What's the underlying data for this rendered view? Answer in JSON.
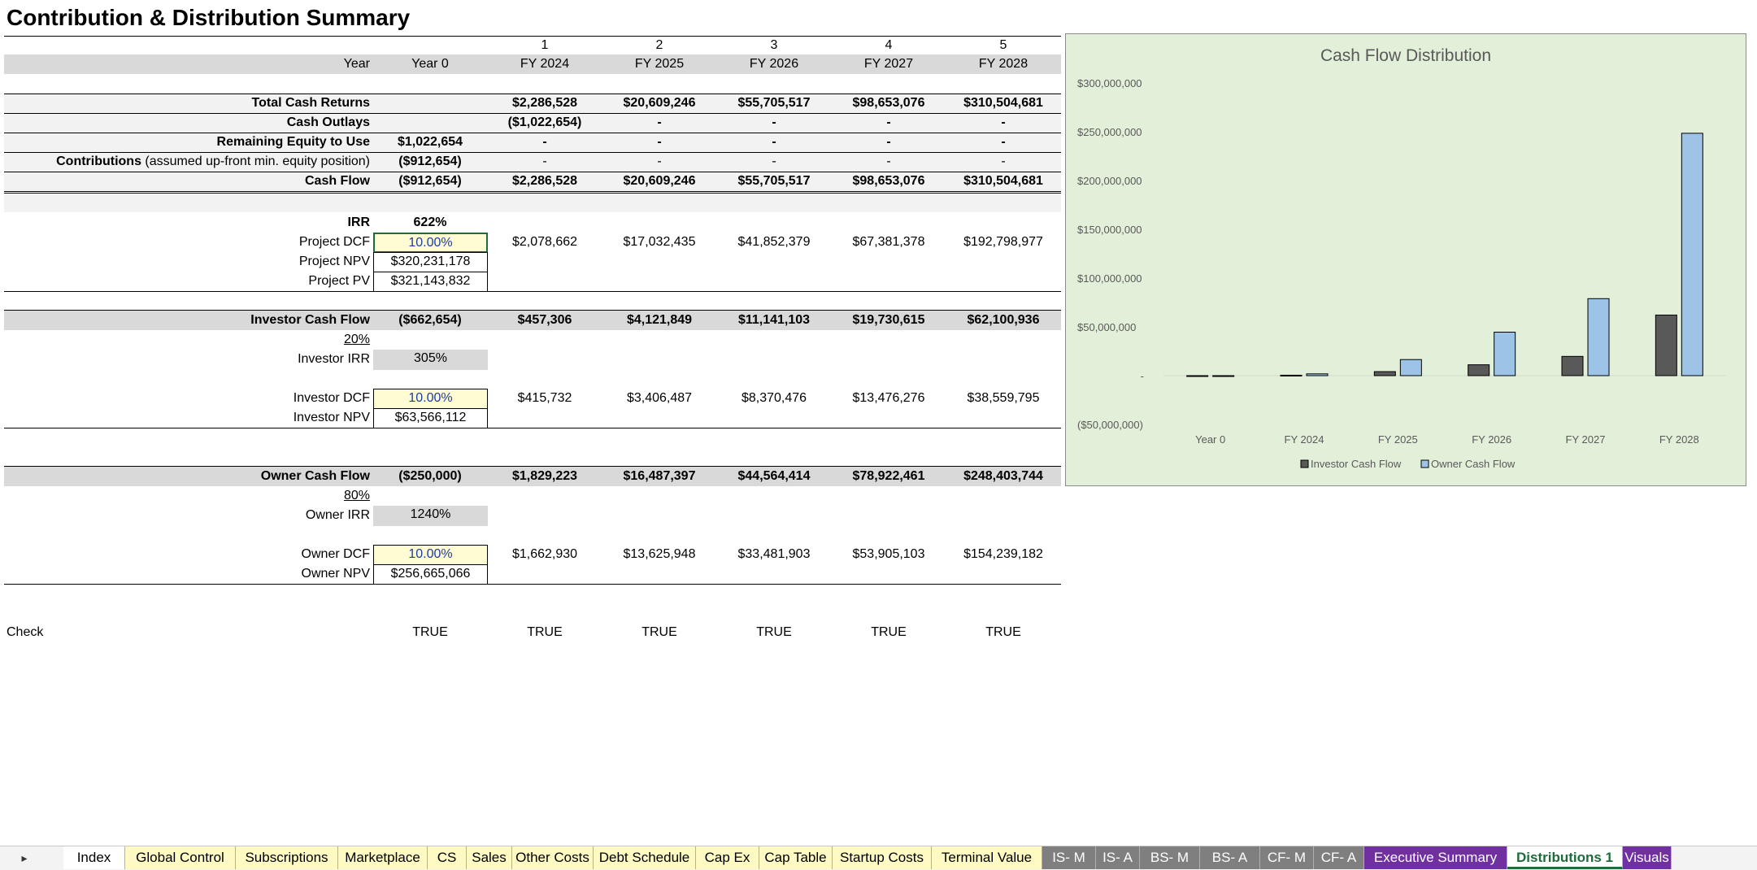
{
  "sheet": {
    "title": "Contribution & Distribution Summary",
    "period_numbers": [
      "1",
      "2",
      "3",
      "4",
      "5"
    ],
    "header": {
      "label": "Year",
      "cols": [
        "Year 0",
        "FY 2024",
        "FY 2025",
        "FY 2026",
        "FY 2027",
        "FY 2028"
      ]
    },
    "total_cash_returns": {
      "label": "Total Cash Returns",
      "cols": [
        "",
        "$2,286,528",
        "$20,609,246",
        "$55,705,517",
        "$98,653,076",
        "$310,504,681"
      ]
    },
    "cash_outlays": {
      "label": "Cash Outlays",
      "cols": [
        "",
        "($1,022,654)",
        "-",
        "-",
        "-",
        "-"
      ]
    },
    "remaining_equity": {
      "label": "Remaining Equity to Use",
      "cols": [
        "$1,022,654",
        "-",
        "-",
        "-",
        "-",
        "-"
      ]
    },
    "contributions": {
      "label_bold": "Contributions",
      "label_rest": " (assumed up-front min. equity position)",
      "cols": [
        "($912,654)",
        "-",
        "-",
        "-",
        "-",
        "-"
      ]
    },
    "cash_flow": {
      "label": "Cash Flow",
      "cols": [
        "($912,654)",
        "$2,286,528",
        "$20,609,246",
        "$55,705,517",
        "$98,653,076",
        "$310,504,681"
      ]
    },
    "irr": {
      "label": "IRR",
      "value": "622%"
    },
    "project_dcf": {
      "label": "Project DCF",
      "rate": "10.00%",
      "cols": [
        "$2,078,662",
        "$17,032,435",
        "$41,852,379",
        "$67,381,378",
        "$192,798,977"
      ]
    },
    "project_npv": {
      "label": "Project NPV",
      "value": "$320,231,178"
    },
    "project_pv": {
      "label": "Project PV",
      "value": "$321,143,832"
    },
    "investor_cash_flow": {
      "label": "Investor Cash Flow",
      "cols": [
        "($662,654)",
        "$457,306",
        "$4,121,849",
        "$11,141,103",
        "$19,730,615",
        "$62,100,936"
      ]
    },
    "investor_share": "20%",
    "investor_irr": {
      "label": "Investor IRR",
      "value": "305%"
    },
    "investor_dcf": {
      "label": "Investor DCF",
      "rate": "10.00%",
      "cols": [
        "$415,732",
        "$3,406,487",
        "$8,370,476",
        "$13,476,276",
        "$38,559,795"
      ]
    },
    "investor_npv": {
      "label": "Investor NPV",
      "value": "$63,566,112"
    },
    "owner_cash_flow": {
      "label": "Owner Cash Flow",
      "cols": [
        "($250,000)",
        "$1,829,223",
        "$16,487,397",
        "$44,564,414",
        "$78,922,461",
        "$248,403,744"
      ]
    },
    "owner_share": "80%",
    "owner_irr": {
      "label": "Owner IRR",
      "value": "1240%"
    },
    "owner_dcf": {
      "label": "Owner DCF",
      "rate": "10.00%",
      "cols": [
        "$1,662,930",
        "$13,625,948",
        "$33,481,903",
        "$53,905,103",
        "$154,239,182"
      ]
    },
    "owner_npv": {
      "label": "Owner NPV",
      "value": "$256,665,066"
    },
    "check": {
      "label": "Check",
      "cols": [
        "TRUE",
        "TRUE",
        "TRUE",
        "TRUE",
        "TRUE",
        "TRUE"
      ]
    }
  },
  "chart_data": {
    "type": "bar",
    "title": "Cash Flow Distribution",
    "categories": [
      "Year 0",
      "FY 2024",
      "FY 2025",
      "FY 2026",
      "FY 2027",
      "FY 2028"
    ],
    "series": [
      {
        "name": "Investor Cash Flow",
        "color": "#595959",
        "values": [
          -662654,
          457306,
          4121849,
          11141103,
          19730615,
          62100936
        ]
      },
      {
        "name": "Owner Cash Flow",
        "color": "#9dc3e6",
        "values": [
          -250000,
          1829223,
          16487397,
          44564414,
          78922461,
          248403744
        ]
      }
    ],
    "y_ticks": [
      {
        "value": 300000000,
        "label": "$300,000,000"
      },
      {
        "value": 250000000,
        "label": "$250,000,000"
      },
      {
        "value": 200000000,
        "label": "$200,000,000"
      },
      {
        "value": 150000000,
        "label": "$150,000,000"
      },
      {
        "value": 100000000,
        "label": "$100,000,000"
      },
      {
        "value": 50000000,
        "label": "$50,000,000"
      },
      {
        "value": 0,
        "label": "-"
      },
      {
        "value": -50000000,
        "label": "($50,000,000)"
      }
    ],
    "ylim": [
      -50000000,
      300000000
    ],
    "grid": false,
    "legend": "bottom"
  },
  "tabs": [
    {
      "label": "Index",
      "style": "white"
    },
    {
      "label": "Global Control",
      "style": "yellow"
    },
    {
      "label": "Subscriptions",
      "style": "yellow"
    },
    {
      "label": "Marketplace",
      "style": "yellow"
    },
    {
      "label": "CS",
      "style": "yellow"
    },
    {
      "label": "Sales",
      "style": "yellow"
    },
    {
      "label": "Other Costs",
      "style": "yellow"
    },
    {
      "label": "Debt Schedule",
      "style": "yellow"
    },
    {
      "label": "Cap Ex",
      "style": "yellow"
    },
    {
      "label": "Cap Table",
      "style": "yellow"
    },
    {
      "label": "Startup Costs",
      "style": "yellow"
    },
    {
      "label": "Terminal Value",
      "style": "yellow"
    },
    {
      "label": "IS- M",
      "style": "grey"
    },
    {
      "label": "IS- A",
      "style": "grey"
    },
    {
      "label": "BS- M",
      "style": "grey"
    },
    {
      "label": "BS- A",
      "style": "grey"
    },
    {
      "label": "CF- M",
      "style": "grey"
    },
    {
      "label": "CF- A",
      "style": "grey"
    },
    {
      "label": "Executive Summary",
      "style": "purple"
    },
    {
      "label": "Distributions 1",
      "style": "active"
    },
    {
      "label": "Visuals",
      "style": "purple"
    }
  ]
}
